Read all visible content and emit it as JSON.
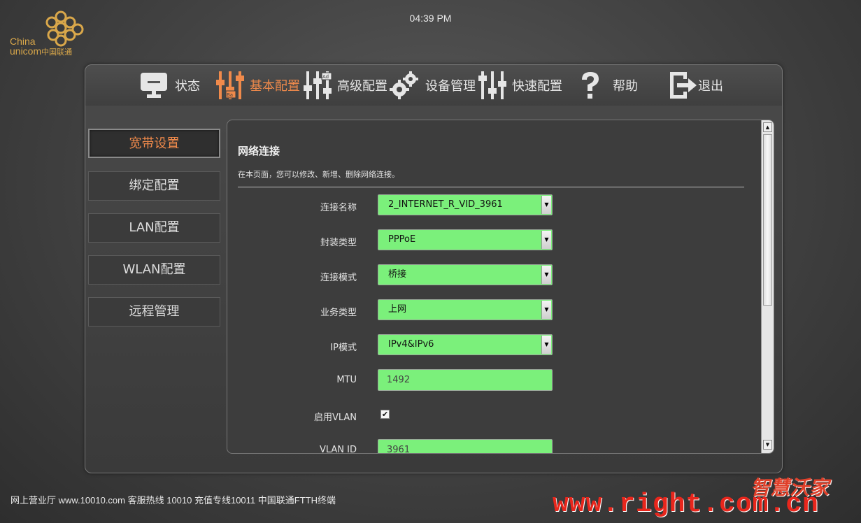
{
  "brand": {
    "name_en_1": "China",
    "name_en_2": "unicom",
    "name_cn": "中国联通"
  },
  "clock": "04:39 PM",
  "nav": [
    {
      "label": "状态",
      "icon": "monitor-icon"
    },
    {
      "label": "基本配置",
      "icon": "sliders-basic-icon",
      "badge": "Ba"
    },
    {
      "label": "高级配置",
      "icon": "sliders-advanced-icon",
      "badge": "Ad"
    },
    {
      "label": "设备管理",
      "icon": "gears-icon"
    },
    {
      "label": "快速配置",
      "icon": "sliders-quick-icon"
    },
    {
      "label": "帮助",
      "icon": "question-icon"
    },
    {
      "label": "退出",
      "icon": "logout-icon"
    }
  ],
  "side_menu": [
    "宽带设置",
    "绑定配置",
    "LAN配置",
    "WLAN配置",
    "远程管理"
  ],
  "content": {
    "title": "网络连接",
    "description": "在本页面，您可以修改、新增、删除网络连接。",
    "fields": {
      "conn_name_label": "连接名称",
      "conn_name_value": "2_INTERNET_R_VID_3961",
      "encap_label": "封装类型",
      "encap_value": "PPPoE",
      "conn_mode_label": "连接模式",
      "conn_mode_value": "桥接",
      "service_label": "业务类型",
      "service_value": "上网",
      "ip_mode_label": "IP模式",
      "ip_mode_value": "IPv4&IPv6",
      "mtu_label": "MTU",
      "mtu_value": "1492",
      "vlan_enable_label": "启用VLAN",
      "vlan_enable_checked": true,
      "vlan_id_label": "VLAN ID",
      "vlan_id_value": "3961"
    }
  },
  "footer": "网上营业厅 www.10010.com 客服热线 10010 充值专线10011 中国联通FTTH终端",
  "watermark": {
    "cn": "智慧沃家",
    "url": "www.right.com.cn"
  },
  "colors": {
    "accent": "#f08a4b",
    "field_bg": "#7bf07b",
    "brand_gold": "#d9a74a",
    "watermark_red": "#e8261c"
  }
}
